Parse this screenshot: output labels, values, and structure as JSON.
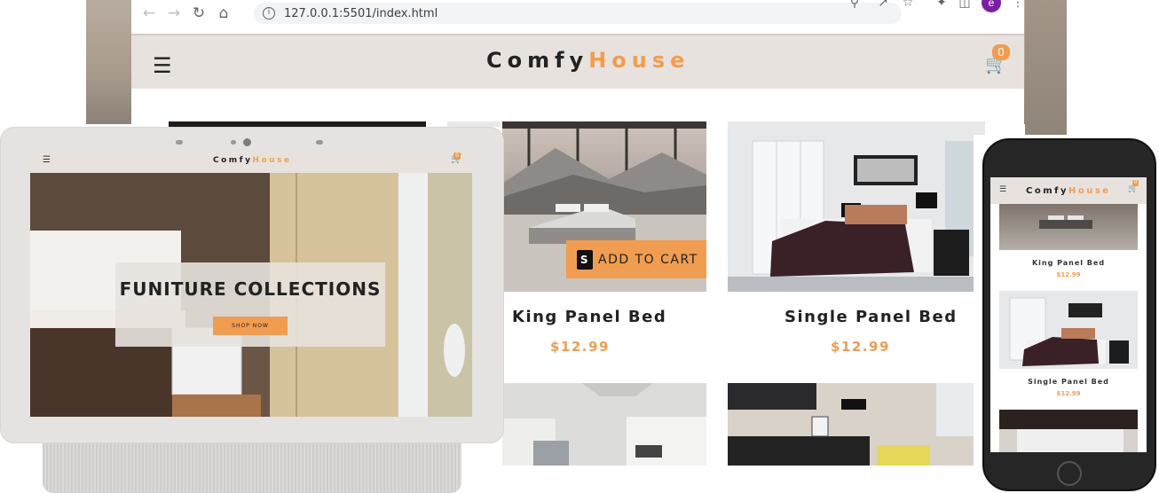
{
  "browser": {
    "url": "127.0.0.1:5501/index.html",
    "back_icon": "arrow-left-icon",
    "forward_icon": "arrow-right-icon",
    "reload_icon": "reload-icon",
    "home_icon": "home-icon",
    "profile_initial": "e"
  },
  "site": {
    "logo_part1": "Comfy",
    "logo_part2": "House",
    "cart_count": "0",
    "accent": "#f09d51",
    "nav_bg": "#e7e2dd"
  },
  "products": [
    {
      "title": "King Panel Bed",
      "price": "$12.99"
    },
    {
      "title": "Single Panel Bed",
      "price": "$12.99"
    }
  ],
  "add_to_cart_label": "ADD TO CART",
  "tablet": {
    "logo_part1": "Comfy",
    "logo_part2": "House",
    "cart_count": "0",
    "banner_title": "FUNITURE COLLECTIONS",
    "banner_button": "SHOP NOW"
  },
  "phone": {
    "logo_part1": "Comfy",
    "logo_part2": "House",
    "cart_count": "0",
    "products": [
      {
        "title": "King Panel Bed",
        "price": "$12.99"
      },
      {
        "title": "Single Panel Bed",
        "price": "$12.99"
      }
    ]
  }
}
